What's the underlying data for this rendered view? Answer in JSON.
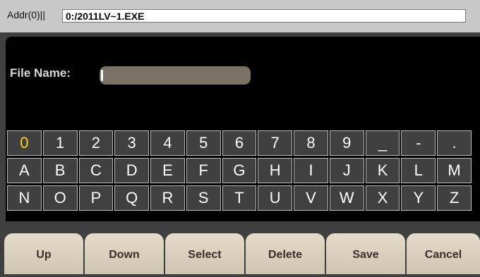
{
  "address": {
    "label": "Addr(0)||",
    "path": "0:/2011LV~1.EXE"
  },
  "file_name": {
    "label": "File Name:",
    "value": ""
  },
  "keyboard": {
    "rows": [
      [
        "0",
        "1",
        "2",
        "3",
        "4",
        "5",
        "6",
        "7",
        "8",
        "9",
        "_",
        "-",
        "."
      ],
      [
        "A",
        "B",
        "C",
        "D",
        "E",
        "F",
        "G",
        "H",
        "I",
        "J",
        "K",
        "L",
        "M"
      ],
      [
        "N",
        "O",
        "P",
        "Q",
        "R",
        "S",
        "T",
        "U",
        "V",
        "W",
        "X",
        "Y",
        "Z"
      ]
    ],
    "selected": "0",
    "selected_color": "#ffd21a"
  },
  "softkeys": {
    "up": "Up",
    "down": "Down",
    "select": "Select",
    "delete": "Delete",
    "save": "Save",
    "cancel": "Cancel"
  }
}
